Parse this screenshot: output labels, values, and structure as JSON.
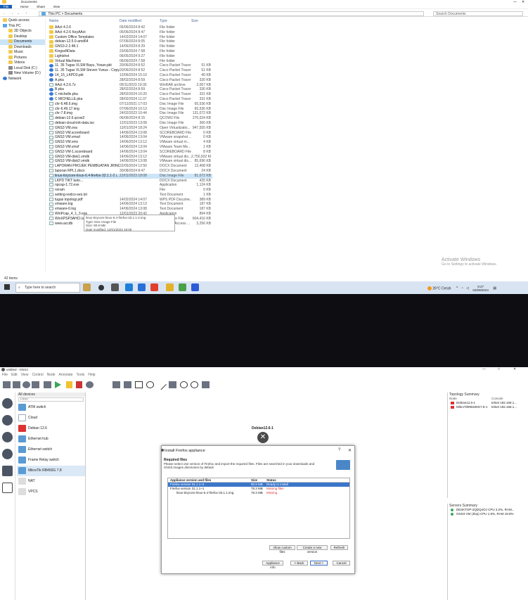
{
  "explorer": {
    "window_title": "Documents",
    "ribbon": {
      "file": "File",
      "home": "Home",
      "share": "Share",
      "view": "View"
    },
    "address": {
      "root": "This PC",
      "sep": ">",
      "folder": "Documents"
    },
    "search_placeholder": "Search Documents",
    "nav": [
      {
        "label": "Quick access",
        "icon": "star-icon",
        "sub": false
      },
      {
        "label": "This PC",
        "icon": "pc-icon",
        "sub": false
      },
      {
        "label": "3D Objects",
        "icon": "folder-icon",
        "sub": true
      },
      {
        "label": "Desktop",
        "icon": "folder-icon",
        "sub": true
      },
      {
        "label": "Documents",
        "icon": "folder-icon",
        "sub": true,
        "selected": true
      },
      {
        "label": "Downloads",
        "icon": "download-icon",
        "sub": true
      },
      {
        "label": "Music",
        "icon": "music-icon",
        "sub": true
      },
      {
        "label": "Pictures",
        "icon": "folder-icon",
        "sub": true
      },
      {
        "label": "Videos",
        "icon": "folder-icon",
        "sub": true
      },
      {
        "label": "Local Disk (C:)",
        "icon": "drive-icon",
        "sub": true
      },
      {
        "label": "New Volume (D:)",
        "icon": "drive-icon",
        "sub": true
      },
      {
        "label": "Network",
        "icon": "network-icon",
        "sub": false
      }
    ],
    "columns": {
      "name": "Name",
      "date": "Date modified",
      "type": "Type",
      "size": "Size"
    },
    "files": [
      {
        "name": "AAct 4.2.6",
        "date": "05/06/2024 8:42",
        "type": "File folder",
        "size": "",
        "kind": "folder"
      },
      {
        "name": "AAct 4.2.6 KeyAAct",
        "date": "05/06/2024 8:47",
        "type": "File folder",
        "size": "",
        "kind": "folder"
      },
      {
        "name": "Custom Office Templates",
        "date": "14/02/2024 14:07",
        "type": "File folder",
        "size": "",
        "kind": "folder"
      },
      {
        "name": "debian-12.5.0-amd64",
        "date": "07/06/2024 8:05",
        "type": "File folder",
        "size": "",
        "kind": "folder"
      },
      {
        "name": "GNS3-2.2.48.1",
        "date": "14/06/2024 8:29",
        "type": "File folder",
        "size": "",
        "kind": "folder"
      },
      {
        "name": "KingsoftData",
        "date": "23/06/2024 7:58",
        "type": "File folder",
        "size": "",
        "kind": "folder"
      },
      {
        "name": "Lightshot",
        "date": "06/05/2024 9:27",
        "type": "File folder",
        "size": "",
        "kind": "folder"
      },
      {
        "name": "Virtual Machines",
        "date": "06/06/2024 7:58",
        "type": "File folder",
        "size": "",
        "kind": "folder"
      },
      {
        "name": "11. 35 Tugas VLSM Bayu, Yosan.pkt",
        "date": "20/06/2024 8:52",
        "type": "Cisco Packet Tracer",
        "size": "51 KB",
        "kind": "pkt"
      },
      {
        "name": "11. 35 Tugas VLSM Steven Yunus - Copy...",
        "date": "20/06/2024 8:52",
        "type": "Cisco Packet Tracer",
        "size": "51 KB",
        "kind": "pkt"
      },
      {
        "name": "14_15_LKPD3.pkt",
        "date": "12/06/2024 15:10",
        "type": "Cisco Packet Tracer",
        "size": "40 KB",
        "kind": "pkt"
      },
      {
        "name": "A.pka",
        "date": "28/02/2024 8:59",
        "type": "Cisco Packet Tracer",
        "size": "320 KB",
        "kind": "pkt"
      },
      {
        "name": "AAct 4.2.6.7z",
        "date": "05/11/2023 19:30",
        "type": "WinRAR archive",
        "size": "2,067 KB",
        "kind": "file"
      },
      {
        "name": "B.pka",
        "date": "28/02/2024 8:59",
        "type": "Cisco Packet Tracer",
        "size": "330 KB",
        "kind": "pkt"
      },
      {
        "name": "C michelle.pka",
        "date": "28/02/2024 10:20",
        "type": "Cisco Packet Tracer",
        "size": "331 KB",
        "kind": "pkt"
      },
      {
        "name": "C MICHELLE.pka",
        "date": "28/02/2024 11:37",
        "type": "Cisco Packet Tracer",
        "size": "331 KB",
        "kind": "pkt"
      },
      {
        "name": "chr-6.48.6.img",
        "date": "07/12/2021 17:03",
        "type": "Disc Image File",
        "size": "65,536 KB",
        "kind": "file"
      },
      {
        "name": "chr-6.49.17.img",
        "date": "07/06/2024 10:13",
        "type": "Disc Image File",
        "size": "65,536 KB",
        "kind": "file"
      },
      {
        "name": "chr-7.8.img",
        "date": "24/02/2023 10:44",
        "type": "Disc Image File",
        "size": "131,072 KB",
        "kind": "file"
      },
      {
        "name": "debian-12.6.qcow2",
        "date": "06/06/2024 8:15",
        "type": "QCOW2 File",
        "size": "276,024 KB",
        "kind": "file"
      },
      {
        "name": "debian-cloud-init-data.iso",
        "date": "12/01/2023 13:08",
        "type": "Disc Image File",
        "size": "366 KB",
        "kind": "file"
      },
      {
        "name": "GNS3 VM.ova",
        "date": "13/01/2024 18:24",
        "type": "Open Virtualizatio...",
        "size": "947,555 KB",
        "kind": "file"
      },
      {
        "name": "GNS3 VM.scoreboard",
        "date": "14/06/2024 13:08",
        "type": "SCOREBOARD File",
        "size": "0 KB",
        "kind": "file"
      },
      {
        "name": "GNS3 VM.vmsd",
        "date": "14/06/2024 13:04",
        "type": "VMware snapshot ...",
        "size": "0 KB",
        "kind": "file"
      },
      {
        "name": "GNS3 VM.vmx",
        "date": "14/06/2024 13:12",
        "type": "VMware virtual m...",
        "size": "4 KB",
        "kind": "file"
      },
      {
        "name": "GNS3 VM.vmxf",
        "date": "14/06/2024 13:04",
        "type": "VMware Team Me...",
        "size": "1 KB",
        "kind": "file"
      },
      {
        "name": "GNS3 VM-1.scoreboard",
        "date": "14/06/2024 13:04",
        "type": "SCOREBOARD File",
        "size": "8 KB",
        "kind": "file"
      },
      {
        "name": "GNS3 VM-disk1.vmdk",
        "date": "14/06/2024 13:12",
        "type": "VMware virtual dis...",
        "size": "2,750,932 KB",
        "kind": "file"
      },
      {
        "name": "GNS3 VM-disk2.vmdk",
        "date": "14/06/2024 13:08",
        "type": "VMware virtual dis...",
        "size": "85,696 KB",
        "kind": "file"
      },
      {
        "name": "LAPORAN PROJEK PEMBUATAN JRINGN H...",
        "date": "22/05/2024 12:50",
        "type": "DOCX Document",
        "size": "12,408 KB",
        "kind": "file"
      },
      {
        "name": "laporan RPL1.docx",
        "date": "30/08/2024 8:47",
        "type": "DOCX Document",
        "size": "24 KB",
        "kind": "file"
      },
      {
        "name": "linux-tinycore-linux-6.4-firefox-33.1.1-2.i...",
        "date": "12/01/2023 18:08",
        "type": "Disc Image File",
        "size": "81,072 KB",
        "kind": "file",
        "selected": true
      },
      {
        "name": "LKPD TIKT keto...",
        "date": "",
        "type": "DOCX Document",
        "size": "425 KB",
        "kind": "file"
      },
      {
        "name": "npcap-1.72.exe",
        "date": "",
        "type": "Application",
        "size": "1,124 KB",
        "kind": "file"
      },
      {
        "name": "nvram",
        "date": "",
        "type": "File",
        "size": "0 KB",
        "kind": "file"
      },
      {
        "name": "setting-vodco-ses.txt",
        "date": "",
        "type": "Text Document",
        "size": "1 KB",
        "kind": "file"
      },
      {
        "name": "tugas topologi.pdf",
        "date": "14/02/2024 14:07",
        "type": "WPS PDF Docume...",
        "size": "389 KB",
        "kind": "file"
      },
      {
        "name": "vmware.log",
        "date": "14/06/2024 13:13",
        "type": "Text Document",
        "size": "187 KB",
        "kind": "file"
      },
      {
        "name": "vmware-0.log",
        "date": "14/06/2024 13:08",
        "type": "Text Document",
        "size": "187 KB",
        "kind": "file"
      },
      {
        "name": "WinPcap_4_1_3.exe",
        "date": "12/01/2023 20:42",
        "type": "Application",
        "size": "894 KB",
        "kind": "file"
      },
      {
        "name": "WinXPSP3AHCI.iso",
        "date": "29/07/2024 15:13",
        "type": "Disc Image File",
        "size": "604,416 KB",
        "kind": "file"
      },
      {
        "name": "www.accdb",
        "date": "01/08/2024 8:25",
        "type": "Microsoft Access ...",
        "size": "3,256 KB",
        "kind": "file"
      }
    ],
    "tooltip": {
      "l1": "linux-tinycore-linux-6.4-firefox-33.1.1-2.img",
      "l2": "Type: Disc Image File",
      "l3": "Size: 80.9 MB",
      "l4": "Date modified: 12/01/2023 18:08"
    },
    "activate": {
      "title": "Activate Windows",
      "sub": "Go to Settings to activate Windows."
    },
    "status_items": "42 items",
    "taskbar": {
      "search_placeholder": "Type here to search",
      "weather": "26°C Cerah",
      "time": "8:27",
      "date": "04/09/2024"
    }
  },
  "gns3": {
    "title": "untitled - GNS3",
    "menu": [
      "File",
      "Edit",
      "View",
      "Control",
      "Node",
      "Annotate",
      "Tools",
      "Help"
    ],
    "devices_header": "All devices",
    "filter_placeholder": "Filter",
    "devices": [
      {
        "label": "ATM switch",
        "icon": "atm-switch-icon"
      },
      {
        "label": "Cloud",
        "icon": "cloud-icon"
      },
      {
        "label": "Debian 12.6",
        "icon": "debian-icon"
      },
      {
        "label": "Ethernet hub",
        "icon": "ethernet-hub-icon"
      },
      {
        "label": "Ethernet switch",
        "icon": "ethernet-switch-icon"
      },
      {
        "label": "Frame Relay switch",
        "icon": "frame-relay-icon"
      },
      {
        "label": "MikroTik RB450G 7.8",
        "icon": "router-icon",
        "selected": true
      },
      {
        "label": "NAT",
        "icon": "nat-icon"
      },
      {
        "label": "VPCS",
        "icon": "vpcs-icon"
      }
    ],
    "node_label": "Debian12.6-1",
    "dialog": {
      "title": "Install Firefox appliance",
      "help": "?",
      "close": "✕",
      "section": "Required files",
      "desc": "Please select one version of Firefox and import the required files. Files are searched in your downloads and GNS3 images directories by default",
      "col_version": "Appliance version and files",
      "col_size": "Size",
      "col_status": "Status",
      "rows": [
        {
          "name": "Firefox version 31.1.1~2",
          "size": "80.9 MB",
          "status": "Ready to install",
          "selected": true,
          "indent": 0
        },
        {
          "name": "Firefox version 31.1.1~1",
          "size": "78.3 MB",
          "status": "Missing files",
          "selected": false,
          "indent": 0
        },
        {
          "name": "linux-tinycore-linux-6.4-firefox-33.1.1.img",
          "size": "78.3 MB",
          "status": "Missing",
          "selected": false,
          "indent": 1
        }
      ],
      "btn_allow_custom": "Allow custom files",
      "btn_create": "Create a new version",
      "btn_refresh": "Refresh",
      "btn_info": "Appliance info",
      "btn_back": "< Back",
      "btn_next": "Next >",
      "btn_cancel": "Cancel"
    },
    "topology": {
      "header": "Topology Summary",
      "col_node": "Node",
      "col_console": "Console",
      "rows": [
        {
          "node": "Debian12.6-1",
          "console": "telnet 192.168.1..."
        },
        {
          "node": "MikroTikRB450G7.8-1",
          "console": "telnet 192.168.1..."
        }
      ]
    },
    "servers": {
      "header": "Servers Summary",
      "rows": [
        {
          "label": "DESKTOP-2QDQ4OJ CPU 3.2%, RAM..."
        },
        {
          "label": "GNS3 VM (Jlep) CPU 1.8%, RAM 19.9%"
        }
      ]
    }
  }
}
